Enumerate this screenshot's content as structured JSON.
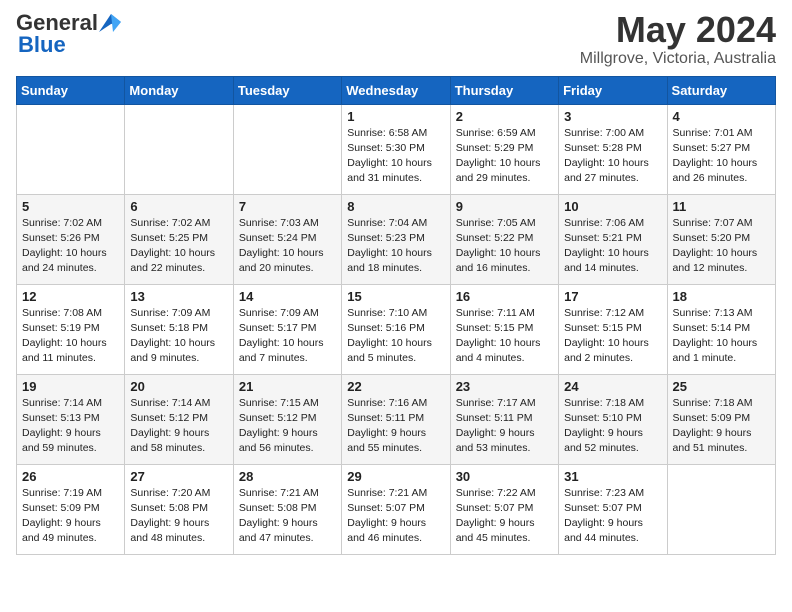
{
  "header": {
    "logo_general": "General",
    "logo_blue": "Blue",
    "title": "May 2024",
    "subtitle": "Millgrove, Victoria, Australia"
  },
  "days_of_week": [
    "Sunday",
    "Monday",
    "Tuesday",
    "Wednesday",
    "Thursday",
    "Friday",
    "Saturday"
  ],
  "weeks": [
    [
      {
        "day": "",
        "info": ""
      },
      {
        "day": "",
        "info": ""
      },
      {
        "day": "",
        "info": ""
      },
      {
        "day": "1",
        "info": "Sunrise: 6:58 AM\nSunset: 5:30 PM\nDaylight: 10 hours and 31 minutes."
      },
      {
        "day": "2",
        "info": "Sunrise: 6:59 AM\nSunset: 5:29 PM\nDaylight: 10 hours and 29 minutes."
      },
      {
        "day": "3",
        "info": "Sunrise: 7:00 AM\nSunset: 5:28 PM\nDaylight: 10 hours and 27 minutes."
      },
      {
        "day": "4",
        "info": "Sunrise: 7:01 AM\nSunset: 5:27 PM\nDaylight: 10 hours and 26 minutes."
      }
    ],
    [
      {
        "day": "5",
        "info": "Sunrise: 7:02 AM\nSunset: 5:26 PM\nDaylight: 10 hours and 24 minutes."
      },
      {
        "day": "6",
        "info": "Sunrise: 7:02 AM\nSunset: 5:25 PM\nDaylight: 10 hours and 22 minutes."
      },
      {
        "day": "7",
        "info": "Sunrise: 7:03 AM\nSunset: 5:24 PM\nDaylight: 10 hours and 20 minutes."
      },
      {
        "day": "8",
        "info": "Sunrise: 7:04 AM\nSunset: 5:23 PM\nDaylight: 10 hours and 18 minutes."
      },
      {
        "day": "9",
        "info": "Sunrise: 7:05 AM\nSunset: 5:22 PM\nDaylight: 10 hours and 16 minutes."
      },
      {
        "day": "10",
        "info": "Sunrise: 7:06 AM\nSunset: 5:21 PM\nDaylight: 10 hours and 14 minutes."
      },
      {
        "day": "11",
        "info": "Sunrise: 7:07 AM\nSunset: 5:20 PM\nDaylight: 10 hours and 12 minutes."
      }
    ],
    [
      {
        "day": "12",
        "info": "Sunrise: 7:08 AM\nSunset: 5:19 PM\nDaylight: 10 hours and 11 minutes."
      },
      {
        "day": "13",
        "info": "Sunrise: 7:09 AM\nSunset: 5:18 PM\nDaylight: 10 hours and 9 minutes."
      },
      {
        "day": "14",
        "info": "Sunrise: 7:09 AM\nSunset: 5:17 PM\nDaylight: 10 hours and 7 minutes."
      },
      {
        "day": "15",
        "info": "Sunrise: 7:10 AM\nSunset: 5:16 PM\nDaylight: 10 hours and 5 minutes."
      },
      {
        "day": "16",
        "info": "Sunrise: 7:11 AM\nSunset: 5:15 PM\nDaylight: 10 hours and 4 minutes."
      },
      {
        "day": "17",
        "info": "Sunrise: 7:12 AM\nSunset: 5:15 PM\nDaylight: 10 hours and 2 minutes."
      },
      {
        "day": "18",
        "info": "Sunrise: 7:13 AM\nSunset: 5:14 PM\nDaylight: 10 hours and 1 minute."
      }
    ],
    [
      {
        "day": "19",
        "info": "Sunrise: 7:14 AM\nSunset: 5:13 PM\nDaylight: 9 hours and 59 minutes."
      },
      {
        "day": "20",
        "info": "Sunrise: 7:14 AM\nSunset: 5:12 PM\nDaylight: 9 hours and 58 minutes."
      },
      {
        "day": "21",
        "info": "Sunrise: 7:15 AM\nSunset: 5:12 PM\nDaylight: 9 hours and 56 minutes."
      },
      {
        "day": "22",
        "info": "Sunrise: 7:16 AM\nSunset: 5:11 PM\nDaylight: 9 hours and 55 minutes."
      },
      {
        "day": "23",
        "info": "Sunrise: 7:17 AM\nSunset: 5:11 PM\nDaylight: 9 hours and 53 minutes."
      },
      {
        "day": "24",
        "info": "Sunrise: 7:18 AM\nSunset: 5:10 PM\nDaylight: 9 hours and 52 minutes."
      },
      {
        "day": "25",
        "info": "Sunrise: 7:18 AM\nSunset: 5:09 PM\nDaylight: 9 hours and 51 minutes."
      }
    ],
    [
      {
        "day": "26",
        "info": "Sunrise: 7:19 AM\nSunset: 5:09 PM\nDaylight: 9 hours and 49 minutes."
      },
      {
        "day": "27",
        "info": "Sunrise: 7:20 AM\nSunset: 5:08 PM\nDaylight: 9 hours and 48 minutes."
      },
      {
        "day": "28",
        "info": "Sunrise: 7:21 AM\nSunset: 5:08 PM\nDaylight: 9 hours and 47 minutes."
      },
      {
        "day": "29",
        "info": "Sunrise: 7:21 AM\nSunset: 5:07 PM\nDaylight: 9 hours and 46 minutes."
      },
      {
        "day": "30",
        "info": "Sunrise: 7:22 AM\nSunset: 5:07 PM\nDaylight: 9 hours and 45 minutes."
      },
      {
        "day": "31",
        "info": "Sunrise: 7:23 AM\nSunset: 5:07 PM\nDaylight: 9 hours and 44 minutes."
      },
      {
        "day": "",
        "info": ""
      }
    ]
  ]
}
